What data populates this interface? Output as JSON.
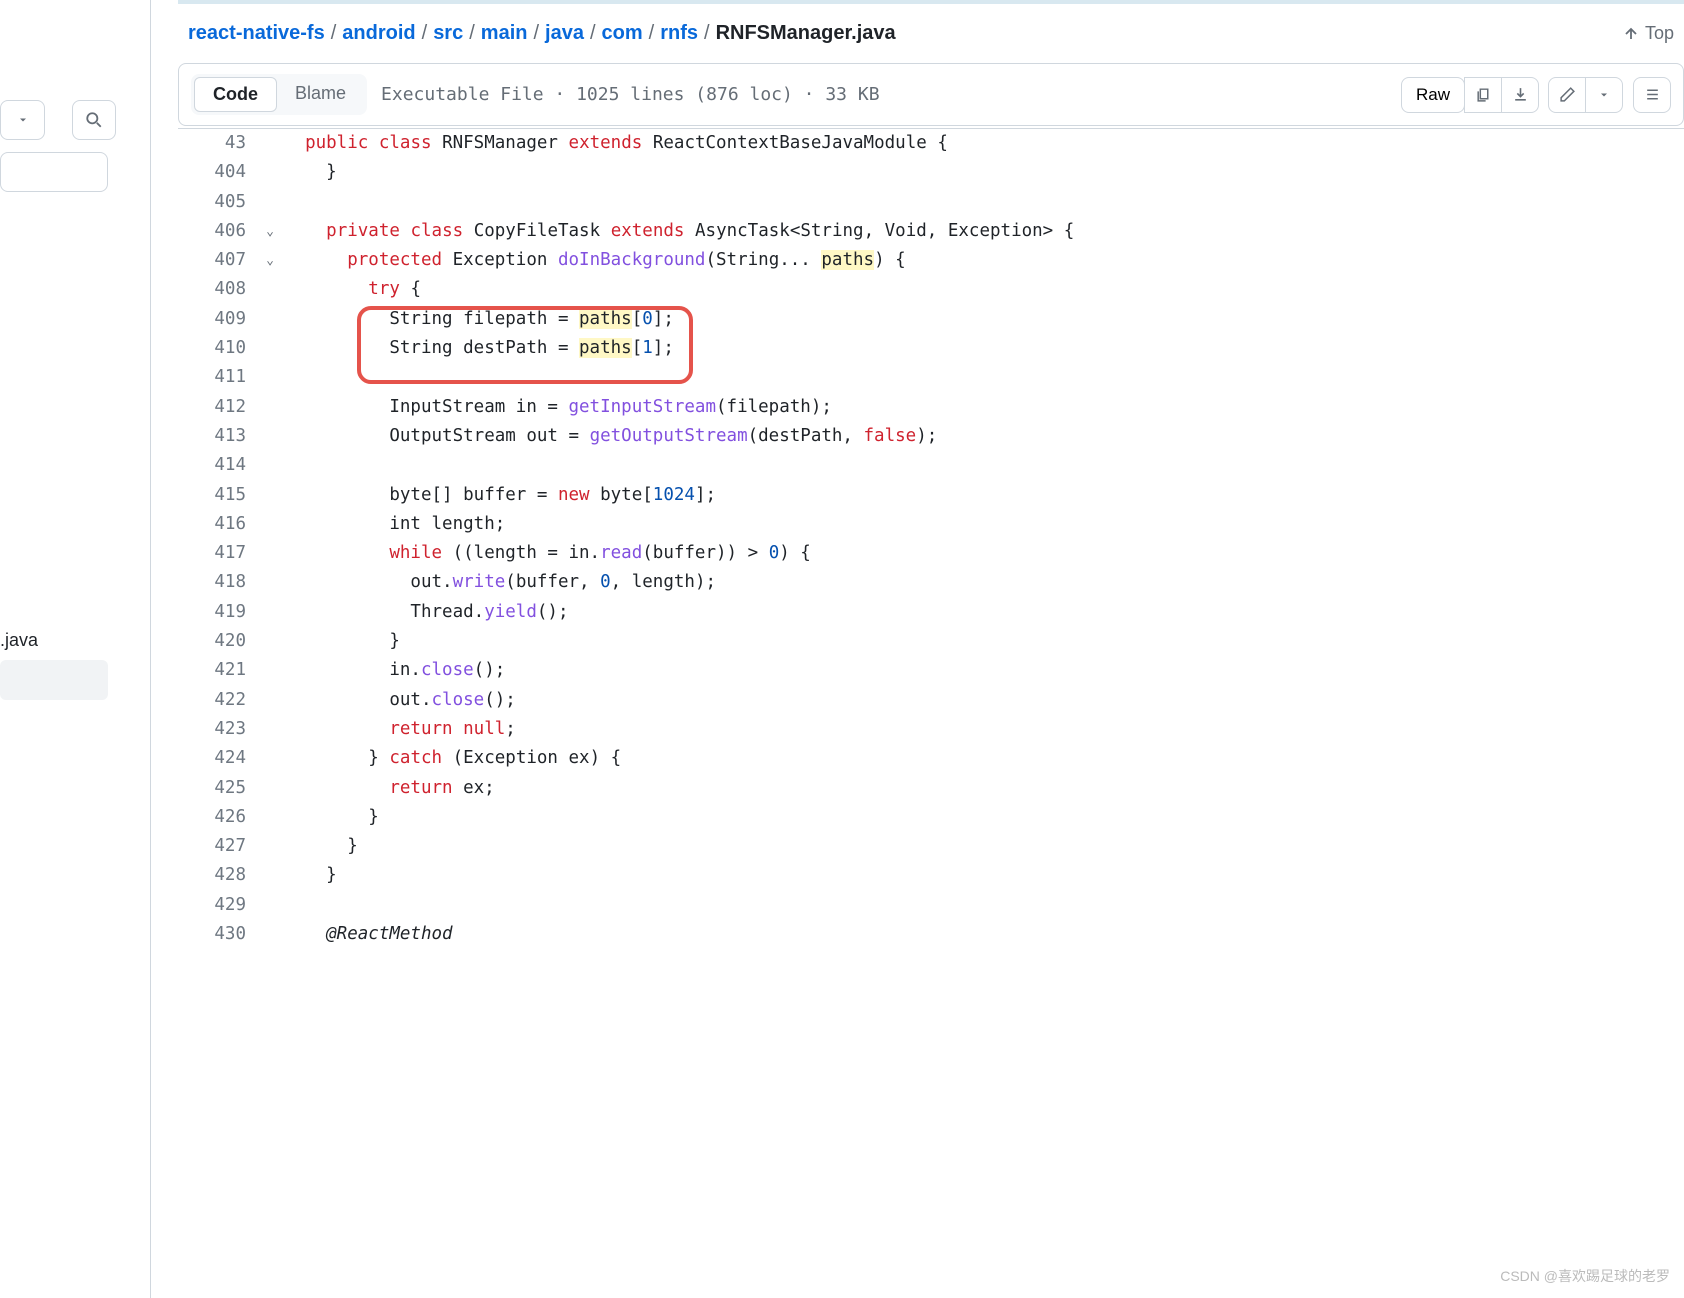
{
  "breadcrumb": {
    "root": "react-native-fs",
    "parts": [
      "android",
      "src",
      "main",
      "java",
      "com",
      "rnfs"
    ],
    "current": "RNFSManager.java",
    "sep": "/"
  },
  "top_link": "Top",
  "tabs": {
    "code": "Code",
    "blame": "Blame"
  },
  "file_info": "Executable File · 1025 lines (876 loc) · 33 KB",
  "raw_label": "Raw",
  "left": {
    "java_label": ".java"
  },
  "lines": [
    {
      "n": "43"
    },
    {
      "n": "404"
    },
    {
      "n": "405"
    },
    {
      "n": "406"
    },
    {
      "n": "407"
    },
    {
      "n": "408"
    },
    {
      "n": "409"
    },
    {
      "n": "410"
    },
    {
      "n": "411"
    },
    {
      "n": "412"
    },
    {
      "n": "413"
    },
    {
      "n": "414"
    },
    {
      "n": "415"
    },
    {
      "n": "416"
    },
    {
      "n": "417"
    },
    {
      "n": "418"
    },
    {
      "n": "419"
    },
    {
      "n": "420"
    },
    {
      "n": "421"
    },
    {
      "n": "422"
    },
    {
      "n": "423"
    },
    {
      "n": "424"
    },
    {
      "n": "425"
    },
    {
      "n": "426"
    },
    {
      "n": "427"
    },
    {
      "n": "428"
    },
    {
      "n": "429"
    },
    {
      "n": "430"
    }
  ],
  "code": {
    "l43": {
      "kw1": "public",
      "kw2": "class",
      "name": "RNFSManager",
      "kw3": "extends",
      "base": "ReactContextBaseJavaModule {"
    },
    "l404": "    }",
    "l406": {
      "kw1": "private",
      "kw2": "class",
      "name": "CopyFileTask",
      "kw3": "extends",
      "rest": "AsyncTask<String, Void, Exception> {"
    },
    "l407": {
      "kw1": "protected",
      "type": "Exception",
      "fn": "doInBackground",
      "sig1": "(String... ",
      "hl": "paths",
      "sig2": ") {"
    },
    "l408": {
      "kw": "try",
      "rest": " {"
    },
    "l409": {
      "pre": "        String filepath = ",
      "hl": "paths",
      "post": "[",
      "num": "0",
      "end": "];"
    },
    "l410": {
      "pre": "        String destPath = ",
      "hl": "paths",
      "post": "[",
      "num": "1",
      "end": "];"
    },
    "l412": {
      "pre": "        InputStream in = ",
      "fn": "getInputStream",
      "post": "(filepath);"
    },
    "l413": {
      "pre": "        OutputStream out = ",
      "fn": "getOutputStream",
      "mid": "(destPath, ",
      "kw": "false",
      "end": ");"
    },
    "l415": {
      "pre": "        byte[] buffer = ",
      "kw": "new",
      "mid": " byte[",
      "num": "1024",
      "end": "];"
    },
    "l416": "        int length;",
    "l417": {
      "kw": "while",
      "mid": " ((length = in.",
      "fn": "read",
      "mid2": "(buffer)) > ",
      "num": "0",
      "end": ") {"
    },
    "l418": {
      "pre": "          out.",
      "fn": "write",
      "mid": "(buffer, ",
      "num": "0",
      "end": ", length);"
    },
    "l419": {
      "pre": "          Thread.",
      "fn": "yield",
      "end": "();"
    },
    "l420": "        }",
    "l421": {
      "pre": "        in.",
      "fn": "close",
      "end": "();"
    },
    "l422": {
      "pre": "        out.",
      "fn": "close",
      "end": "();"
    },
    "l423": {
      "kw": "return",
      "val": "null",
      "end": ";"
    },
    "l424": {
      "pre": "      } ",
      "kw": "catch",
      "end": " (Exception ex) {"
    },
    "l425": {
      "kw": "return",
      "end": " ex;"
    },
    "l426": "      }",
    "l427": "    }",
    "l428": "  }",
    "l430": "  @ReactMethod"
  },
  "watermark": "CSDN @喜欢踢足球的老罗"
}
